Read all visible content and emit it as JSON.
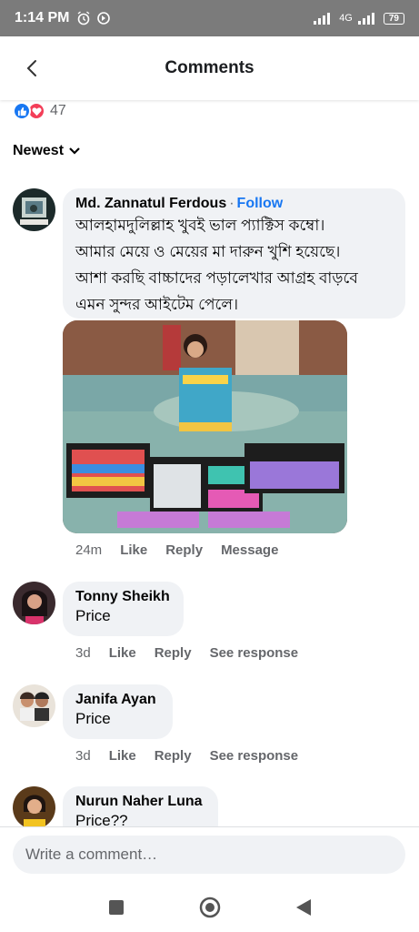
{
  "status_bar": {
    "time": "1:14 PM",
    "network": "4G",
    "battery": "79"
  },
  "header": {
    "title": "Comments"
  },
  "reactions": {
    "count": "47"
  },
  "sort": {
    "label": "Newest"
  },
  "comments": [
    {
      "author": "Md. Zannatul Ferdous",
      "follow": "Follow",
      "lines": [
        "আলহামদুলিল্লাহ খুবই ভাল প্যাক্টিস কম্বো।",
        "আমার মেয়ে ও মেয়ের মা দারুন খুশি হয়েছে।",
        "আশা করছি বাচ্চাদের পড়ালেখার আগ্রহ বাড়বে",
        "এমন সুন্দর আইটেম পেলে।"
      ],
      "time": "24m",
      "like": "Like",
      "reply": "Reply",
      "extra": "Message"
    },
    {
      "author": "Tonny Sheikh",
      "text": "Price",
      "time": "3d",
      "like": "Like",
      "reply": "Reply",
      "extra": "See response"
    },
    {
      "author": "Janifa Ayan",
      "text": "Price",
      "time": "3d",
      "like": "Like",
      "reply": "Reply",
      "extra": "See response"
    },
    {
      "author": "Nurun Naher Luna",
      "text": "Price??"
    }
  ],
  "composer": {
    "placeholder": "Write a comment…"
  },
  "colors": {
    "accent": "#1877f2",
    "bubble": "#f0f2f5",
    "muted": "#65676b"
  }
}
